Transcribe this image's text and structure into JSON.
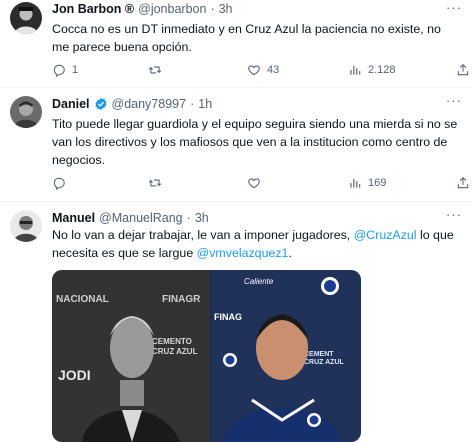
{
  "tweets": [
    {
      "name": "Jon Barbon ®",
      "handle": "@jonbarbon",
      "dot": "·",
      "time": "3h",
      "text": "Cocca no es un DT inmediato y en Cruz Azul la paciencia no existe, no me parece buena opción.",
      "stats": {
        "replies": "1",
        "retweets": "",
        "likes": "43",
        "views": "2.128"
      }
    },
    {
      "name": "Daniel",
      "handle": "@dany78997",
      "dot": "·",
      "time": "1h",
      "text": "Tito puede llegar guardiola y el equipo seguira siendo una mierda si no se van los directivos y los mafiosos que ven a la institucion como centro de negocios.",
      "stats": {
        "replies": "",
        "retweets": "",
        "likes": "",
        "views": "169"
      }
    },
    {
      "name": "Manuel",
      "handle": "@ManuelRang",
      "dot": "·",
      "time": "3h",
      "text_parts": [
        "No lo van a dejar trabajar, le van a imponer jugadores, ",
        "@CruzAzul",
        " lo que necesita es que se largue ",
        "@vmvelazquez1",
        "."
      ],
      "media_text": [
        "NACIONAL",
        "FINAGR",
        "CEMENTO",
        "CRUZ AZUL",
        "JODI",
        "FINAG",
        "Caliente",
        "CEMENT",
        "CRUZ AZUL"
      ]
    }
  ],
  "colors": {
    "accent": "#1d9bf0",
    "secondary_text": "#536471",
    "divider": "#eff3f4"
  },
  "icons": [
    "verified-badge-icon",
    "more-options-icon",
    "reply-icon",
    "retweet-icon",
    "like-icon",
    "views-icon",
    "share-icon"
  ]
}
